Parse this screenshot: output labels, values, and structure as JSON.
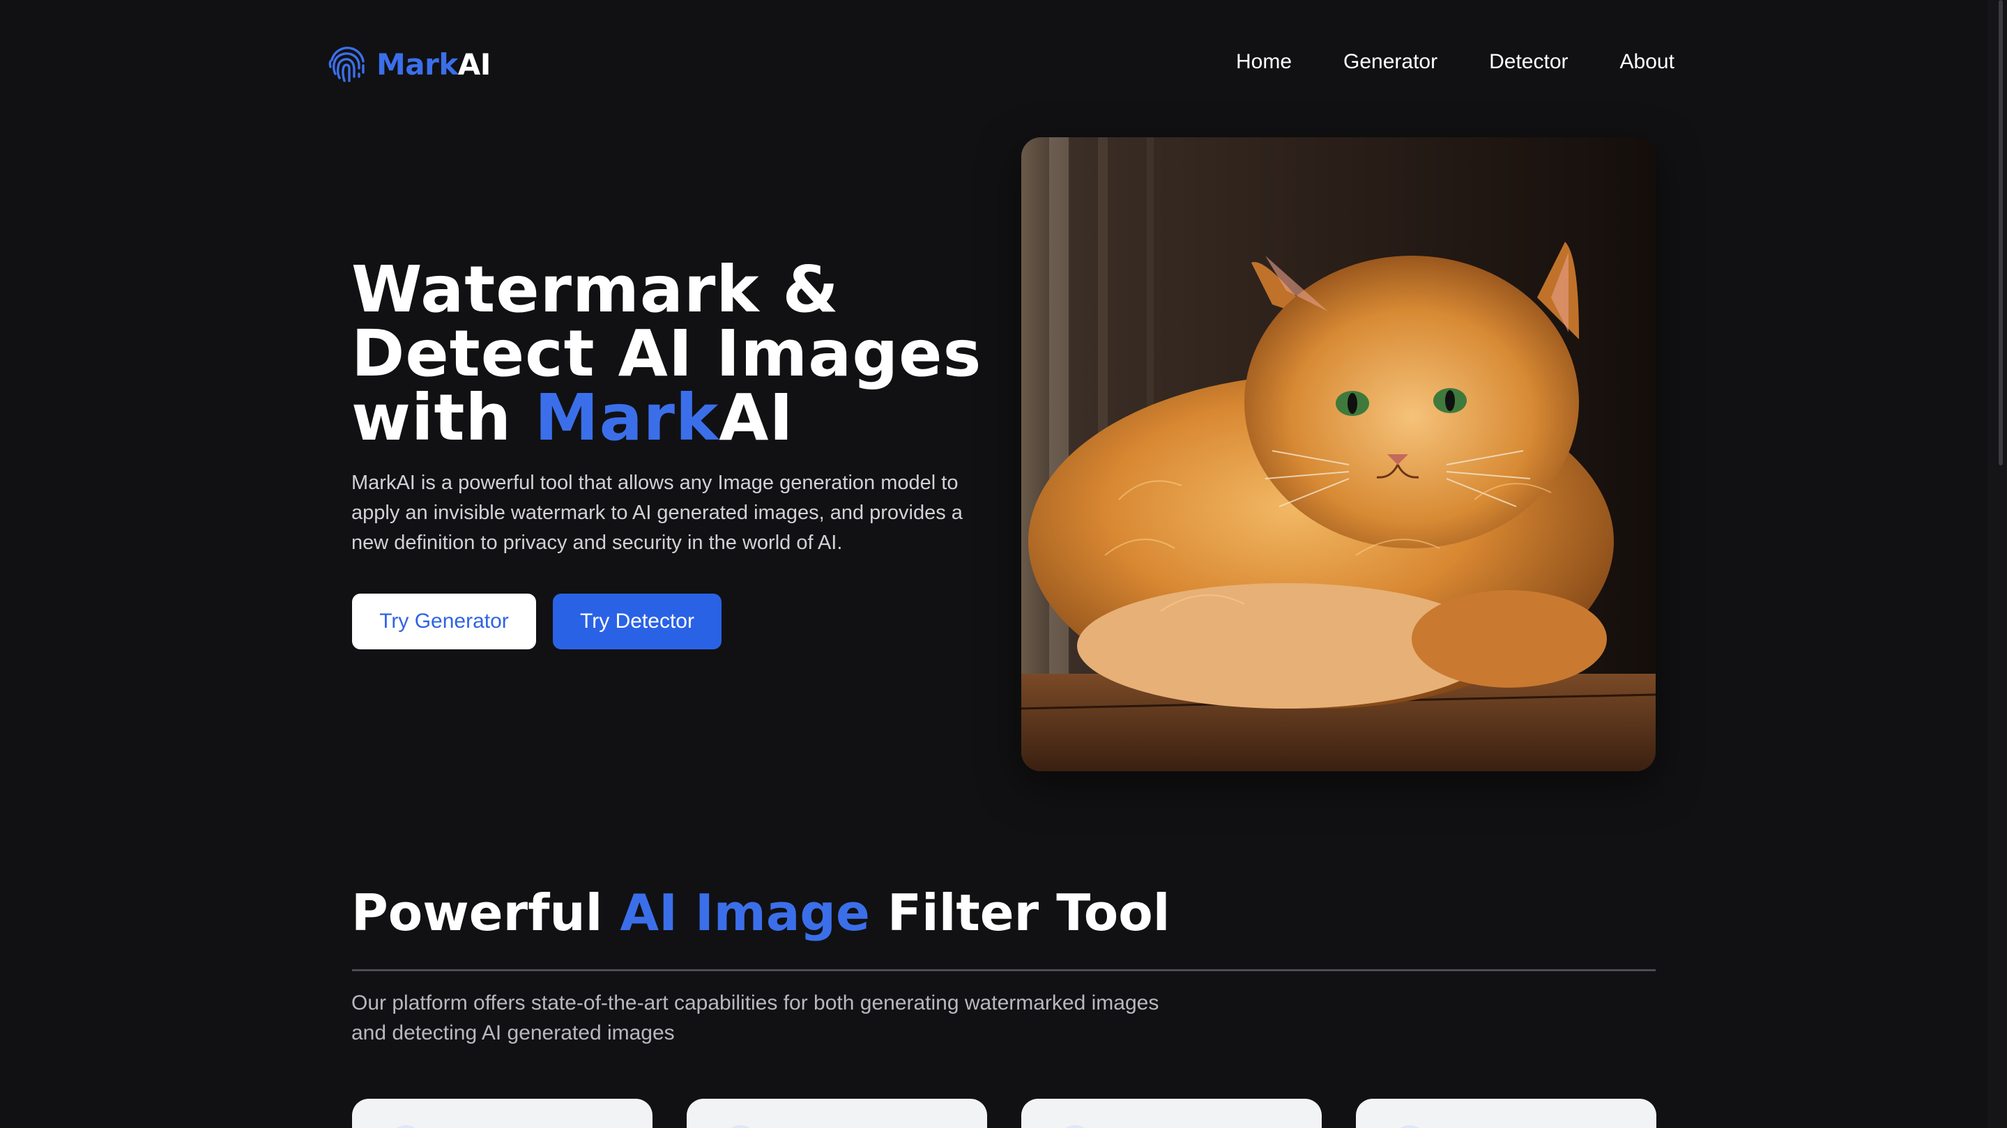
{
  "brand": {
    "mark": "Mark",
    "ai": "AI"
  },
  "nav": {
    "links": [
      "Home",
      "Generator",
      "Detector",
      "About"
    ]
  },
  "hero": {
    "title_line1": "Watermark &",
    "title_line2": "Detect AI Images",
    "title_line3_prefix": "with ",
    "title_line3_mark": "Mark",
    "title_line3_ai": "AI",
    "description": "MarkAI is a powerful tool that allows any Image generation model to apply an invisible watermark to AI generated images, and provides a new definition to privacy and security in the world of AI.",
    "buttons": {
      "generator": "Try Generator",
      "detector": "Try Detector"
    },
    "image_alt": "orange-cat-photo"
  },
  "section": {
    "title_prefix": "Powerful ",
    "title_accent": "AI Image",
    "title_suffix": " Filter Tool",
    "description": "Our platform offers state-of-the-art capabilities for both generating watermarked images and detecting AI generated images"
  },
  "colors": {
    "background": "#111113",
    "accent": "#3b6fea",
    "button_primary": "#2a62e6",
    "button_secondary": "#ffffff"
  },
  "icons": {
    "logo": "fingerprint-icon"
  }
}
